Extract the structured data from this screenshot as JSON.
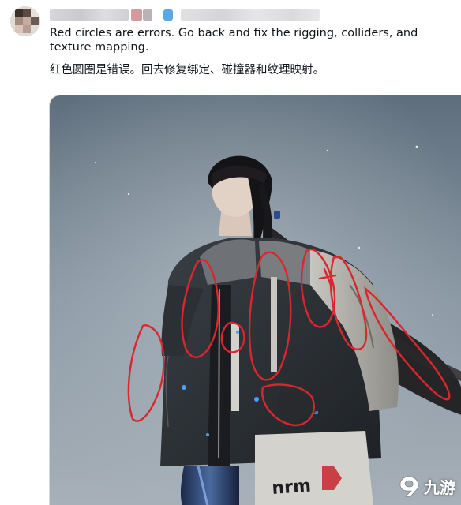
{
  "post": {
    "text_en": "Red circles are errors. Go back and fix the rigging, colliders, and texture mapping.",
    "text_zh": "红色圆圈是错误。回去修复绑定、碰撞器和纹理映射。"
  },
  "media": {
    "jacket_text": "nrm",
    "annotation_color": "#d8272d"
  },
  "watermark": {
    "logo": "9you-logo-icon",
    "text": "九游"
  }
}
